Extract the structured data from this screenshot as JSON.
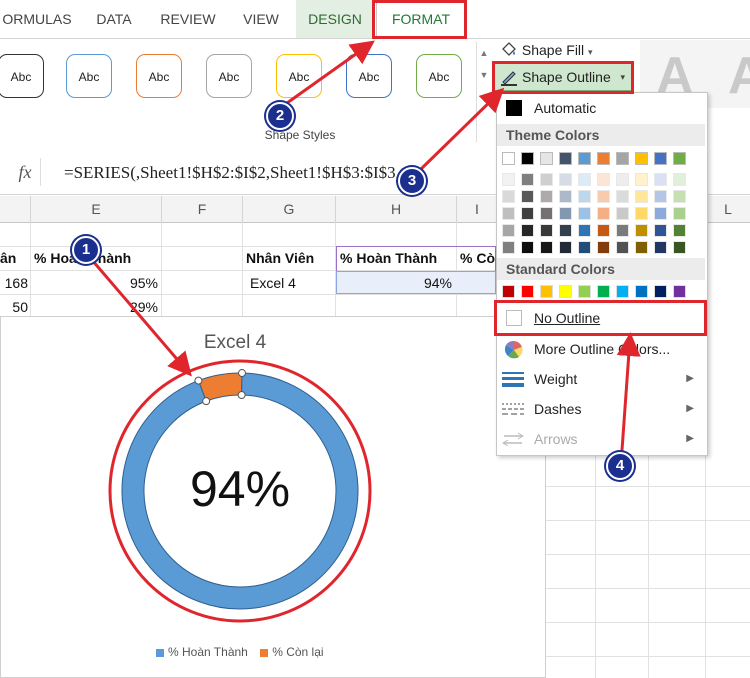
{
  "ribbon": {
    "tabs": [
      {
        "label": "ORMULAS"
      },
      {
        "label": "DATA"
      },
      {
        "label": "REVIEW"
      },
      {
        "label": "VIEW"
      },
      {
        "label": "DESIGN"
      },
      {
        "label": "FORMAT"
      }
    ],
    "swatch_label": "Abc",
    "swatch_colors": [
      "#333333",
      "#5b9bd5",
      "#ed7d31",
      "#a5a5a5",
      "#ffc000",
      "#4472c4",
      "#70ad47"
    ],
    "group_label": "Shape Styles",
    "shape_fill_label": "Shape Fill",
    "shape_outline_label": "Shape Outline",
    "wordart_letter": "A"
  },
  "formula_bar": {
    "fx_label": "fx",
    "formula": "=SERIES(,Sheet1!$H$2:$I$2,Sheet1!$H$3:$I$3,1)"
  },
  "grid": {
    "columns": [
      "E",
      "F",
      "G",
      "H",
      "I",
      "L"
    ],
    "cells": {
      "d2": "ân",
      "e2": "% Hoàn Thành",
      "d3": "168",
      "e3": "95%",
      "d4": "50",
      "e4": "29%",
      "g2": "Nhân Viên",
      "h2": "% Hoàn Thành",
      "i2": "% Còn",
      "g3": "Excel 4",
      "h3": "94%"
    }
  },
  "chart": {
    "title": "Excel 4",
    "center_label": "94%",
    "colors": {
      "complete": "#5b9bd5",
      "remaining": "#ed7d31"
    },
    "legend": [
      {
        "label": "% Hoàn Thành",
        "color": "#5b9bd5"
      },
      {
        "label": "% Còn lại",
        "color": "#ed7d31"
      }
    ]
  },
  "chart_data": {
    "type": "pie",
    "title": "Excel 4",
    "categories": [
      "% Hoàn Thành",
      "% Còn lại"
    ],
    "values": [
      0.94,
      0.06
    ]
  },
  "dropdown": {
    "automatic_label": "Automatic",
    "theme_colors_label": "Theme Colors",
    "standard_colors_label": "Standard Colors",
    "theme_top_row": [
      "#ffffff",
      "#000000",
      "#e7e6e6",
      "#44546a",
      "#5b9bd5",
      "#ed7d31",
      "#a5a5a5",
      "#ffc000",
      "#4472c4",
      "#70ad47"
    ],
    "theme_shades": [
      [
        "#f2f2f2",
        "#7f7f7f",
        "#d0cece",
        "#d6dce4",
        "#ddebf7",
        "#fce4d6",
        "#ededed",
        "#fff2cc",
        "#d9e1f2",
        "#e2efda"
      ],
      [
        "#d9d9d9",
        "#595959",
        "#aeaaaa",
        "#adb9ca",
        "#bdd7ee",
        "#f8cbad",
        "#dbdbdb",
        "#ffe699",
        "#b4c6e7",
        "#c6e0b4"
      ],
      [
        "#bfbfbf",
        "#404040",
        "#757171",
        "#8497b0",
        "#9bc2e6",
        "#f4b084",
        "#c9c9c9",
        "#ffd966",
        "#8ea9db",
        "#a9d08e"
      ],
      [
        "#a6a6a6",
        "#262626",
        "#3a3838",
        "#333f4f",
        "#2f75b5",
        "#c65911",
        "#7b7b7b",
        "#bf8f00",
        "#2f5597",
        "#548235"
      ],
      [
        "#808080",
        "#0d0d0d",
        "#161616",
        "#222b35",
        "#1f4e78",
        "#833c0c",
        "#525252",
        "#7f6000",
        "#203764",
        "#375623"
      ]
    ],
    "standard_colors": [
      "#c00000",
      "#ff0000",
      "#ffc000",
      "#ffff00",
      "#92d050",
      "#00b050",
      "#00b0f0",
      "#0070c0",
      "#002060",
      "#7030a0"
    ],
    "no_outline_label": "No Outline",
    "more_colors_label": "More Outline Colors...",
    "weight_label": "Weight",
    "dashes_label": "Dashes",
    "arrows_label": "Arrows"
  },
  "annotations": {
    "badges": [
      "1",
      "2",
      "3",
      "4"
    ],
    "color": "#e0262d"
  }
}
